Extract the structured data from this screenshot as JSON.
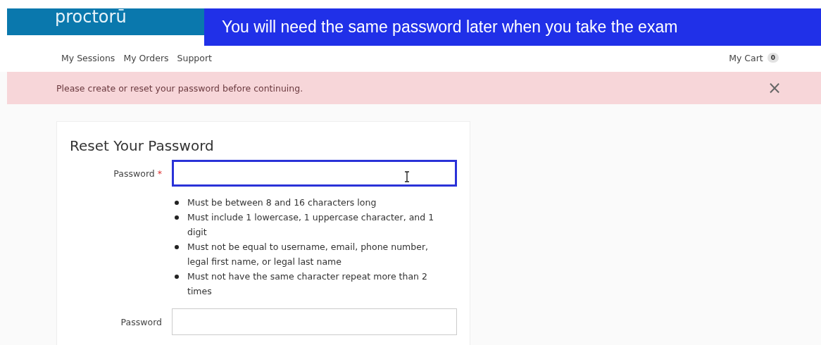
{
  "header": {
    "logo": "proctorū",
    "caption": "You will need the same password later when you take the exam"
  },
  "nav": {
    "items": [
      {
        "label": "My Sessions"
      },
      {
        "label": "My Orders"
      },
      {
        "label": "Support"
      }
    ],
    "cart": {
      "label": "My Cart",
      "count": "0"
    }
  },
  "alert": {
    "message": "Please create or reset your password before continuing.",
    "close": "×"
  },
  "form": {
    "title": "Reset Your Password",
    "fields": [
      {
        "label": "Password",
        "required_mark": "*",
        "focused": true,
        "rules": [
          "Must be between 8 and 16 characters long",
          "Must include 1 lowercase, 1 uppercase character, and 1 digit",
          "Must not be equal to username, email, phone number, legal first name, or legal last name",
          "Must not have the same character repeat more than 2 times"
        ]
      },
      {
        "label": "Password",
        "focused": false
      }
    ]
  }
}
